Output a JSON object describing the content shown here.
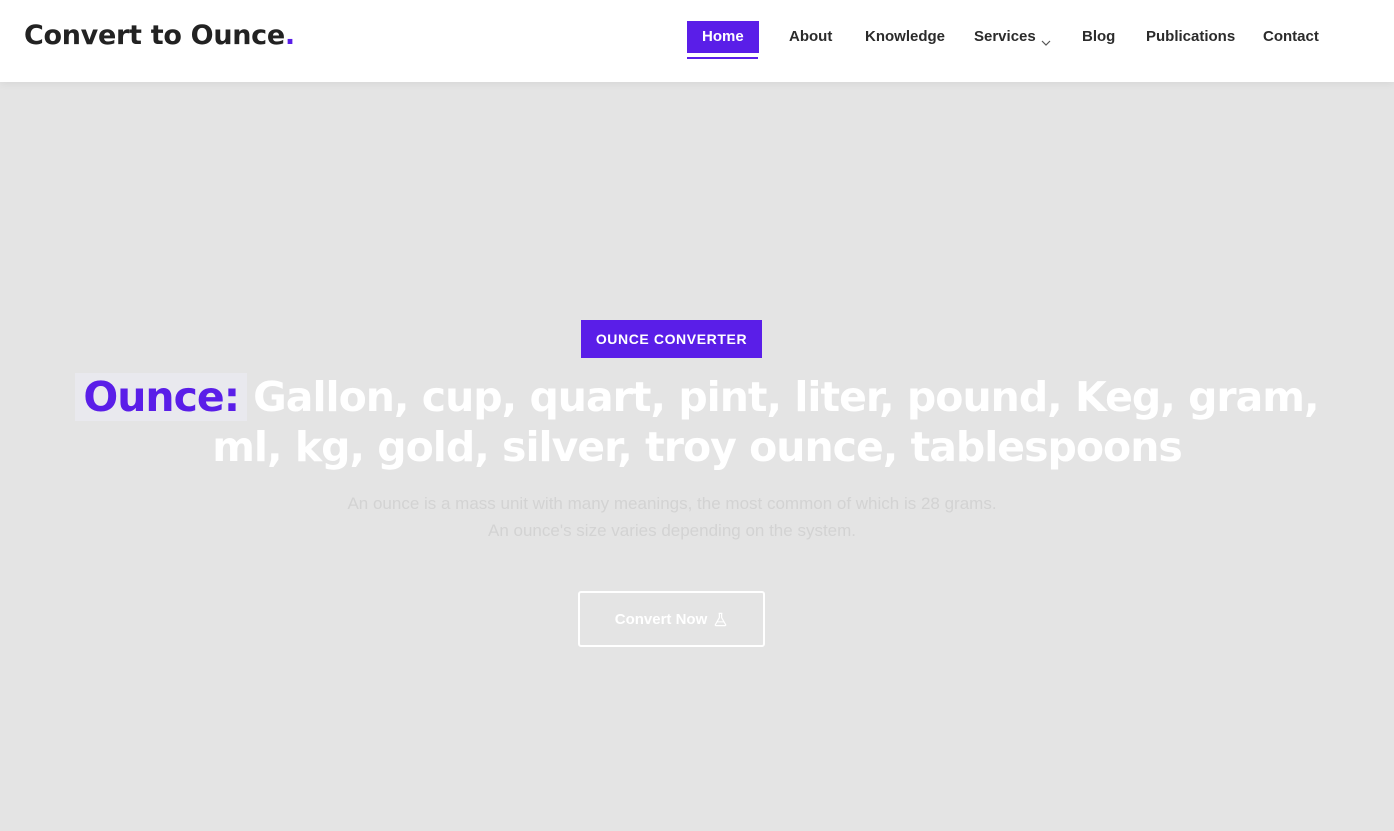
{
  "brand": {
    "name": "Convert to Ounce",
    "dot": "."
  },
  "nav": {
    "items": [
      {
        "label": "Home",
        "active": true
      },
      {
        "label": "About"
      },
      {
        "label": "Knowledge"
      },
      {
        "label": "Services",
        "has_dropdown": true,
        "icon": "chevron-down-icon"
      },
      {
        "label": "Blog"
      },
      {
        "label": "Publications"
      },
      {
        "label": "Contact"
      }
    ]
  },
  "hero": {
    "badge": "OUNCE CONVERTER",
    "headline_accent": "Ounce:",
    "headline_rest": "Gallon, cup, quart, pint, liter, pound, Keg, gram, ml, kg, gold, silver, troy ounce, tablespoons",
    "description": "An ounce is a mass unit with many meanings, the most common of which is 28 grams. An ounce's size varies depending on the system.",
    "cta_label": "Convert Now",
    "cta_icon": "flask-icon"
  },
  "colors": {
    "accent": "#5a1ee8",
    "hero_background": "#e4e4e4",
    "header_background": "#ffffff"
  }
}
